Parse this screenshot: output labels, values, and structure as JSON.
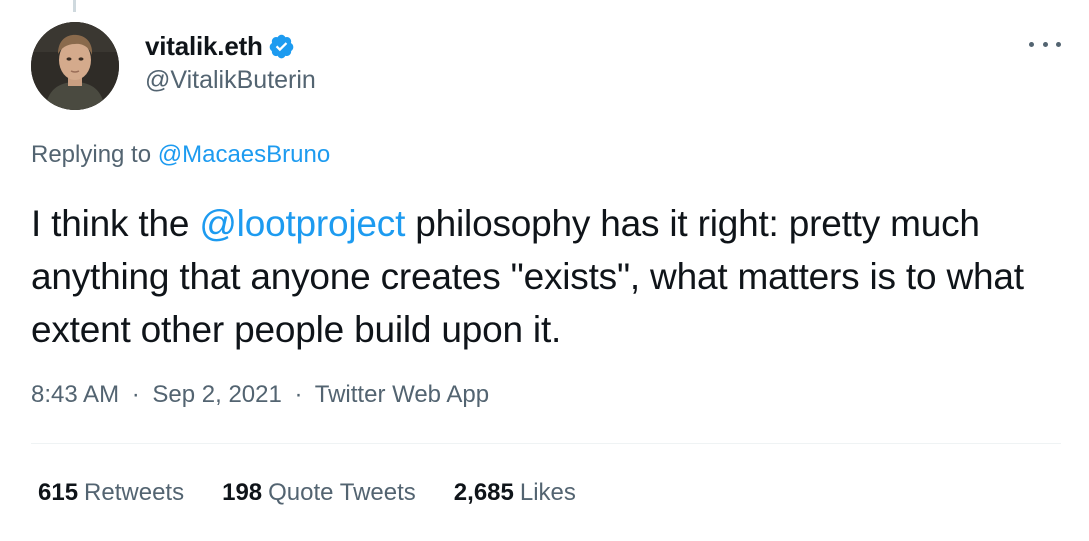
{
  "author": {
    "display_name": "vitalik.eth",
    "handle": "@VitalikButerin",
    "verified": true
  },
  "reply": {
    "prefix": "Replying to",
    "mention": "@MacaesBruno"
  },
  "tweet": {
    "text_before": "I think the ",
    "mention": "@lootproject",
    "text_after": " philosophy has it right: pretty much anything that anyone creates \"exists\", what matters is to what extent other people build upon it."
  },
  "meta": {
    "time": "8:43 AM",
    "date": "Sep 2, 2021",
    "source": "Twitter Web App",
    "separator": "·"
  },
  "stats": {
    "retweets": {
      "count": "615",
      "label": "Retweets"
    },
    "quotes": {
      "count": "198",
      "label": "Quote Tweets"
    },
    "likes": {
      "count": "2,685",
      "label": "Likes"
    }
  },
  "icons": {
    "verified": "verified-badge-icon",
    "more": "more-options-icon"
  },
  "colors": {
    "link": "#1d9bf0",
    "text": "#0f1419",
    "secondary": "#536471",
    "divider": "#eff3f4"
  }
}
